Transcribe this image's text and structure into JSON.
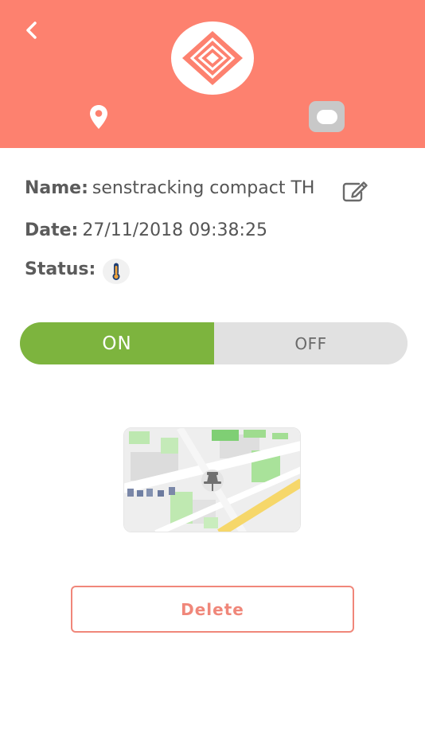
{
  "header": {
    "back_icon": "chevron-left-icon",
    "logo_icon": "diamond-logo-icon",
    "location_icon": "map-pin-icon",
    "device_icon": "device-toggle-icon",
    "background_color": "#fd816f"
  },
  "details": {
    "name_label": "Name:",
    "name_value": "senstracking compact TH",
    "edit_icon": "edit-icon",
    "date_label": "Date:",
    "date_value": "27/11/2018 09:38:25",
    "status_label": "Status:",
    "status_icon": "thermometer-icon"
  },
  "toggle": {
    "on_label": "ON",
    "off_label": "OFF",
    "selected": "ON",
    "on_color": "#7db43e",
    "off_color": "#e1e1e1"
  },
  "map": {
    "pin_icon": "push-pin-icon"
  },
  "actions": {
    "delete_label": "Delete",
    "delete_color": "#f0877a"
  }
}
